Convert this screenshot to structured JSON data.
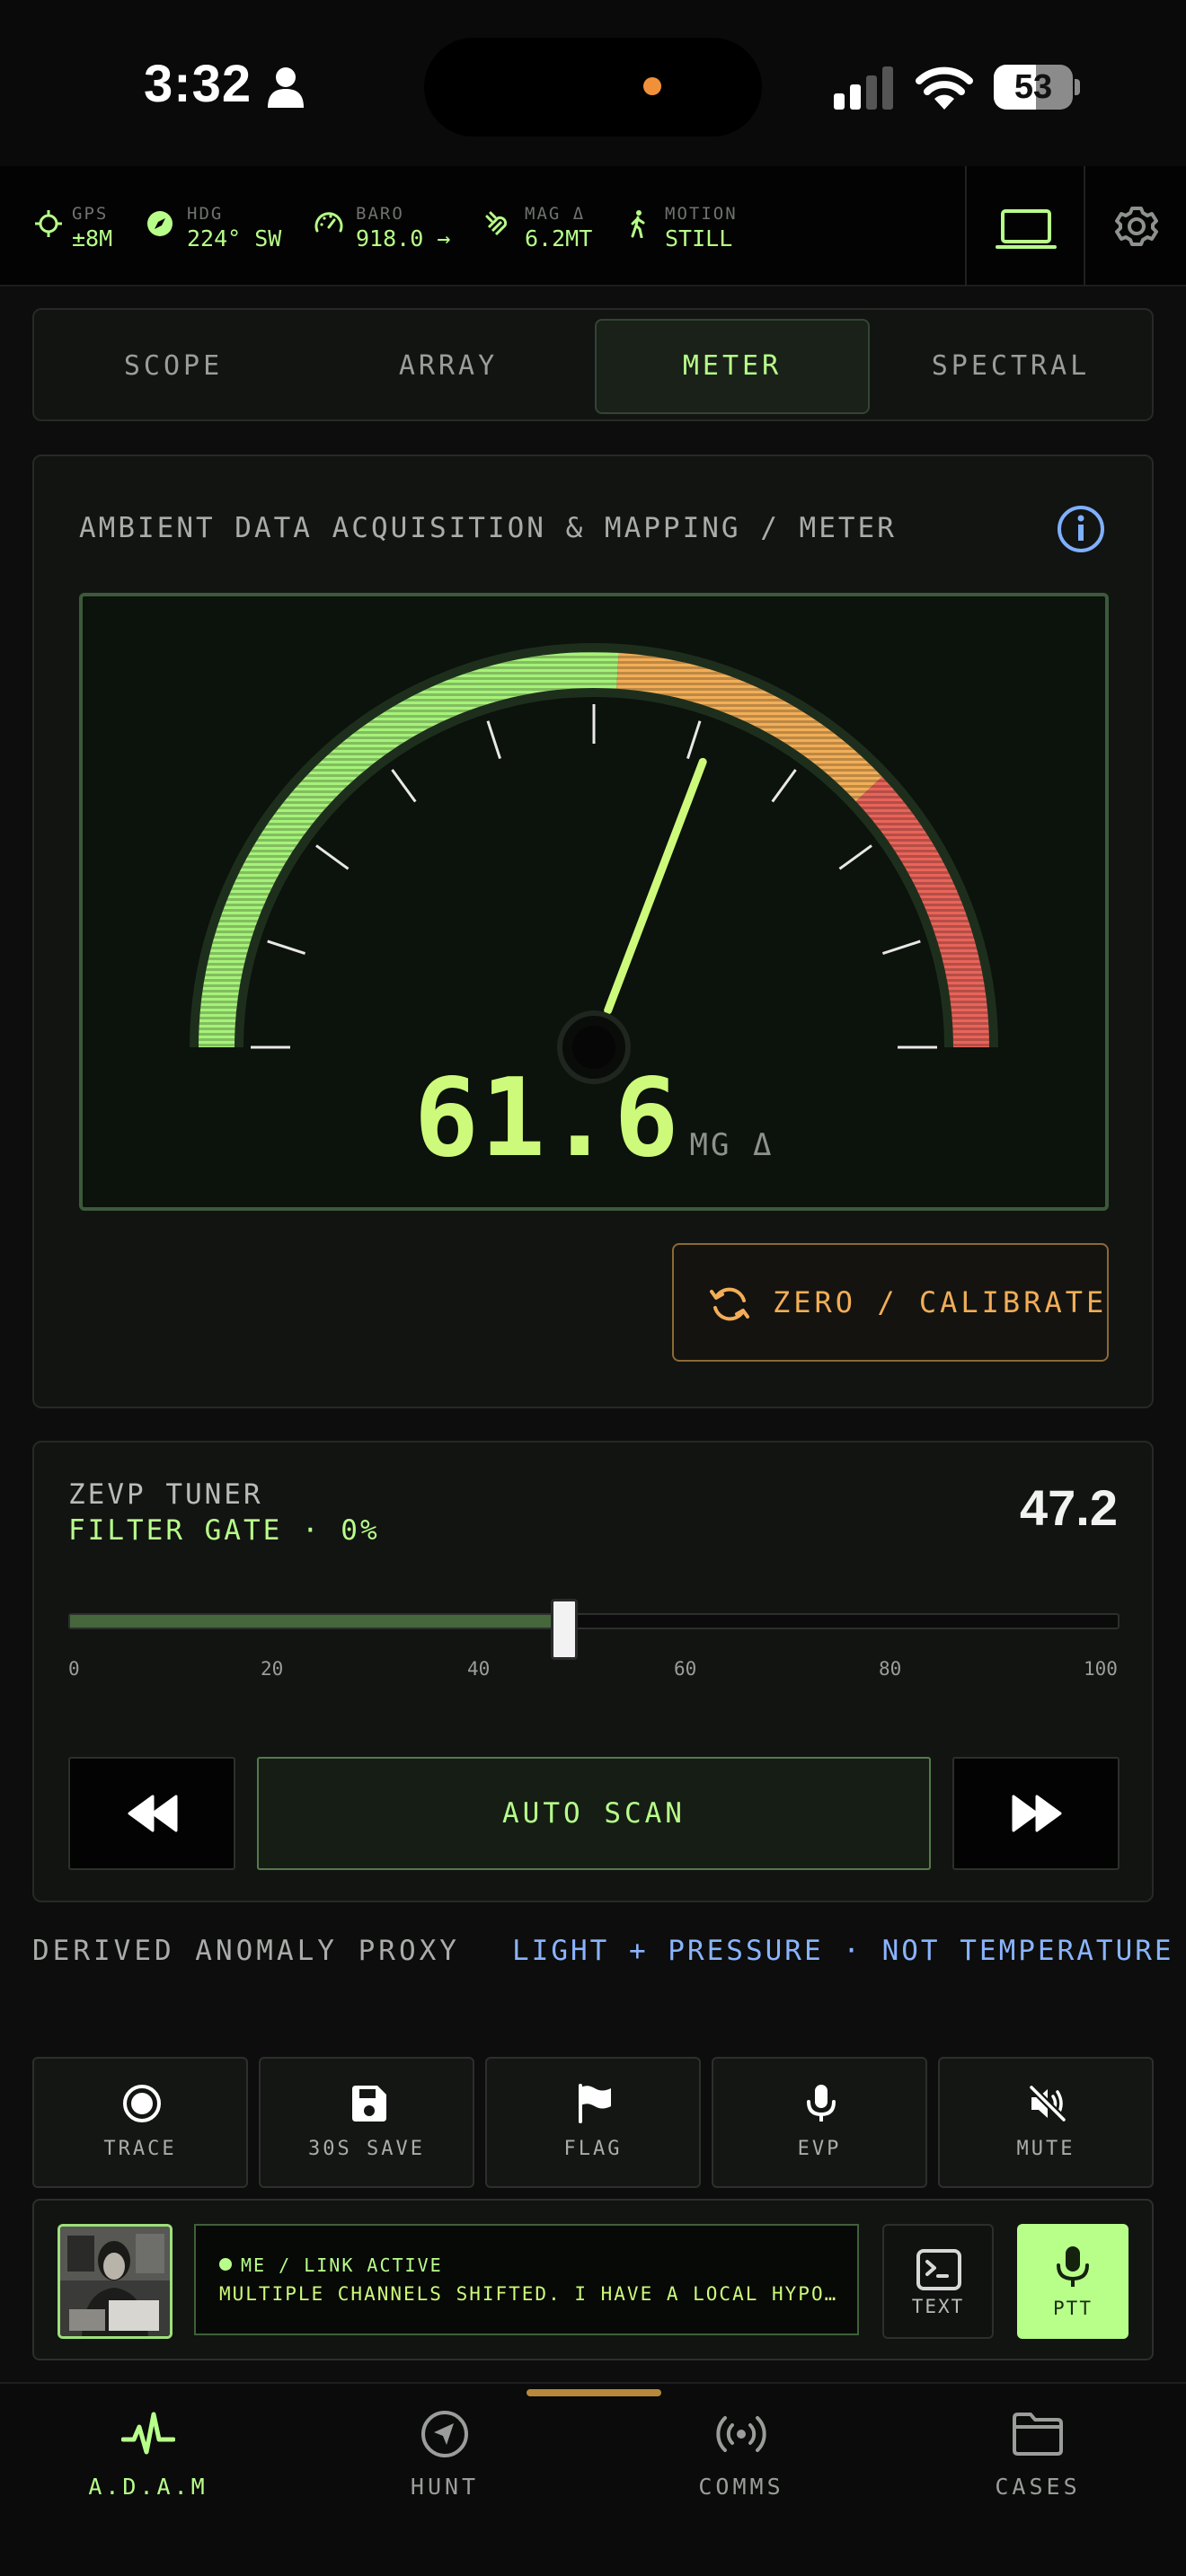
{
  "status": {
    "time": "3:32",
    "battery": "53",
    "battery_level": 0.53
  },
  "telemetry": [
    {
      "label": "GPS",
      "value": "±8M",
      "icon": "crosshair-icon"
    },
    {
      "label": "HDG",
      "value": "224° SW",
      "icon": "compass-icon"
    },
    {
      "label": "BARO",
      "value": "918.0 →",
      "icon": "speedometer-icon"
    },
    {
      "label": "MAG Δ",
      "value": "6.2MT",
      "icon": "magnet-icon"
    },
    {
      "label": "MOTION",
      "value": "STILL",
      "icon": "walking-icon"
    }
  ],
  "tabs": [
    {
      "label": "SCOPE",
      "active": false
    },
    {
      "label": "ARRAY",
      "active": false
    },
    {
      "label": "METER",
      "active": true
    },
    {
      "label": "SPECTRAL",
      "active": false
    }
  ],
  "meter": {
    "title": "AMBIENT DATA ACQUISITION & MAPPING / METER",
    "value": "61.6",
    "unit": "MG Δ",
    "needle_fraction": 0.616,
    "calibrate_label": "ZERO / CALIBRATE",
    "colors": {
      "low": "#a6f27a",
      "mid": "#f2ae57",
      "high": "#e8645a"
    }
  },
  "tuner": {
    "title": "ZEVP TUNER",
    "subtitle": "FILTER GATE · 0%",
    "value": "47.2",
    "slider_value": 47.2,
    "ticks": [
      "0",
      "20",
      "40",
      "60",
      "80",
      "100"
    ],
    "scan_label": "AUTO SCAN"
  },
  "derived": {
    "left": "DERIVED ANOMALY PROXY",
    "right": "LIGHT + PRESSURE · NOT TEMPERATURE"
  },
  "actions": [
    {
      "label": "TRACE",
      "icon": "record-icon"
    },
    {
      "label": "30S SAVE",
      "icon": "floppy-icon"
    },
    {
      "label": "FLAG",
      "icon": "flag-icon"
    },
    {
      "label": "EVP",
      "icon": "microphone-icon"
    },
    {
      "label": "MUTE",
      "icon": "speaker-mute-icon"
    }
  ],
  "comms": {
    "header": "ME / LINK ACTIVE",
    "message": "MULTIPLE CHANNELS SHIFTED. I HAVE A LOCAL HYPOTHESIS FORMING",
    "text_label": "TEXT",
    "ptt_label": "PTT"
  },
  "nav": [
    {
      "label": "A.D.A.M",
      "active": true,
      "icon": "pulse-icon"
    },
    {
      "label": "HUNT",
      "active": false,
      "icon": "navigation-icon"
    },
    {
      "label": "COMMS",
      "active": false,
      "icon": "broadcast-icon"
    },
    {
      "label": "CASES",
      "active": false,
      "icon": "folder-icon"
    }
  ]
}
